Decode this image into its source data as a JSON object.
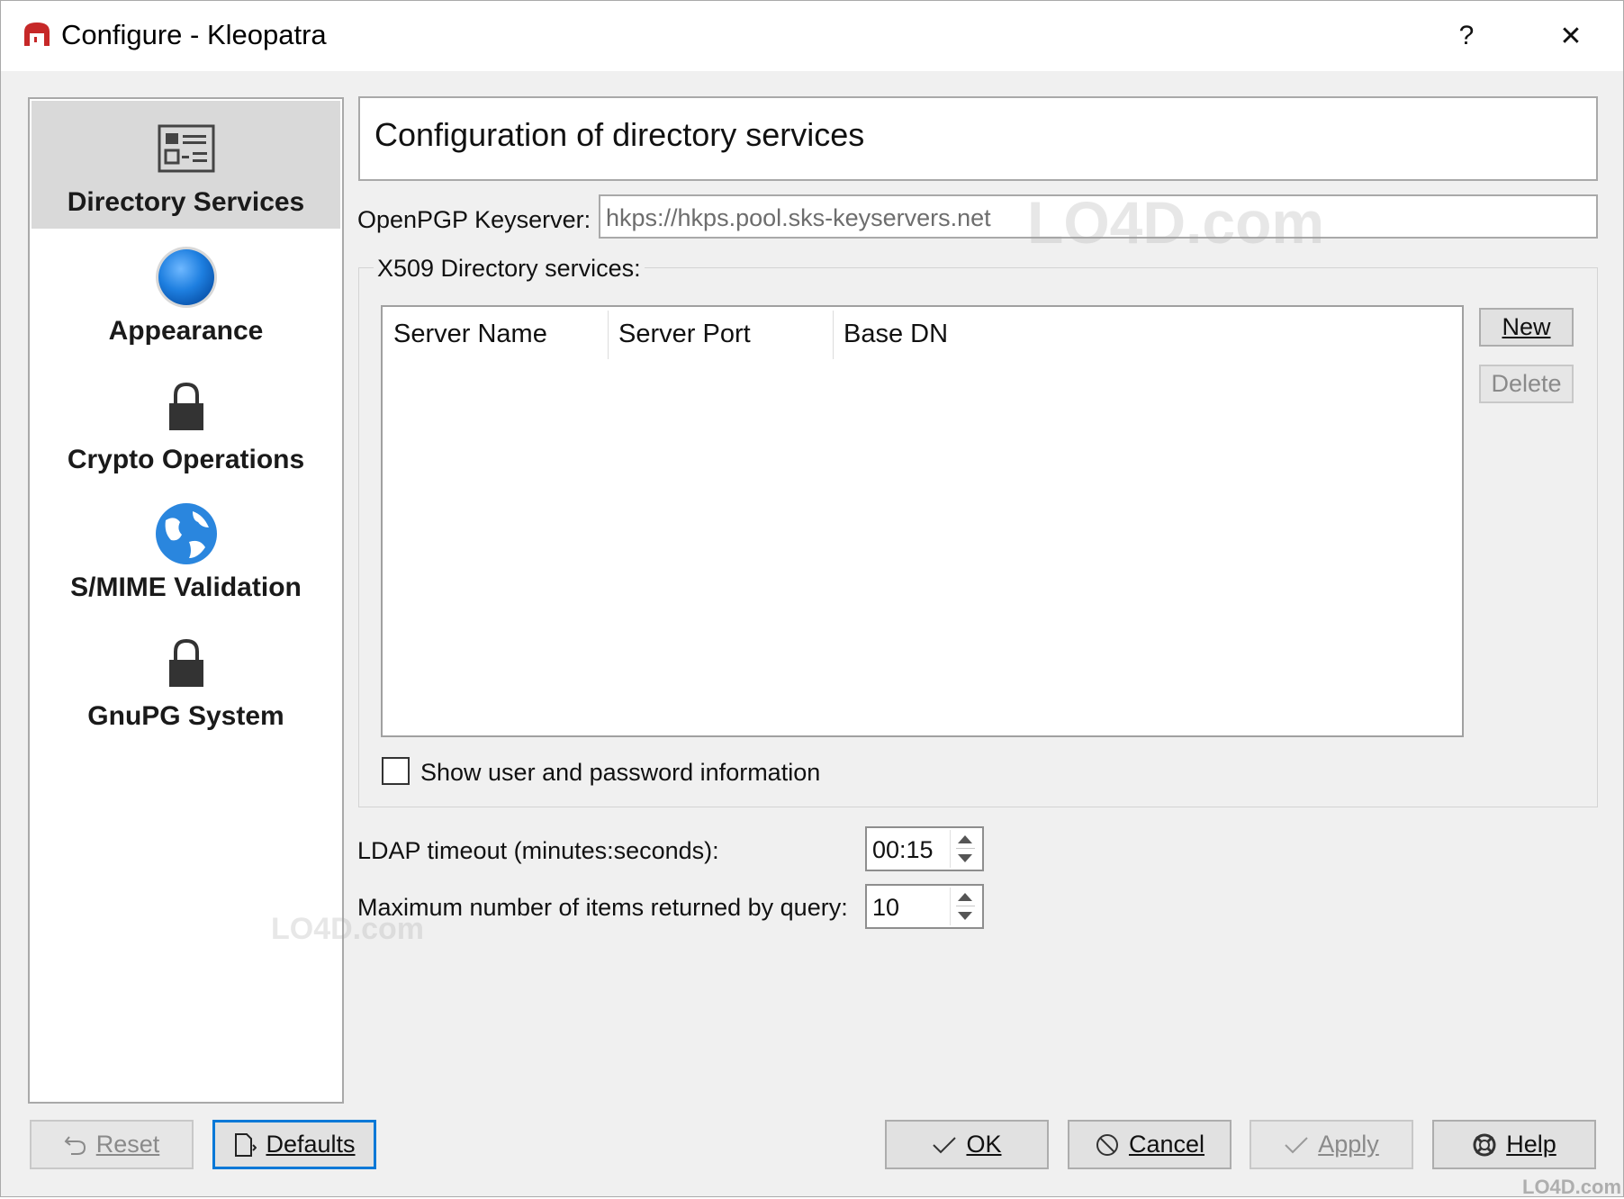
{
  "window": {
    "title": "Configure - Kleopatra",
    "help_glyph": "?",
    "close_glyph": "✕"
  },
  "sidebar": {
    "items": [
      {
        "label": "Directory Services",
        "icon": "address-card-icon",
        "selected": true
      },
      {
        "label": "Appearance",
        "icon": "blue-sphere-icon",
        "selected": false
      },
      {
        "label": "Crypto Operations",
        "icon": "padlock-icon",
        "selected": false
      },
      {
        "label": "S/MIME Validation",
        "icon": "globe-icon",
        "selected": false
      },
      {
        "label": "GnuPG System",
        "icon": "padlock-icon",
        "selected": false
      }
    ]
  },
  "main": {
    "header_title": "Configuration of directory services",
    "keyserver_label": "OpenPGP Keyserver:",
    "keyserver_value": "hkps://hkps.pool.sks-keyservers.net",
    "x509_group_title": "X509 Directory services:",
    "table_columns": [
      "Server Name",
      "Server Port",
      "Base DN"
    ],
    "new_button": "New",
    "delete_button": "Delete",
    "show_user_checkbox_label": "Show user and password information",
    "show_user_checked": false,
    "ldap_timeout_label": "LDAP timeout (minutes:seconds):",
    "ldap_timeout_value": "00:15",
    "max_items_label": "Maximum number of items returned by query:",
    "max_items_value": "10"
  },
  "footer": {
    "reset_button": "Reset",
    "defaults_button": "Defaults",
    "ok_button": "OK",
    "cancel_button": "Cancel",
    "apply_button": "Apply",
    "help_button": "Help"
  },
  "watermark": "LO4D.com",
  "colors": {
    "focus_border": "#0078d7",
    "selected_bg": "#d9d9d9",
    "app_icon_red": "#c62828",
    "appearance_blue": "#1e7fe0"
  }
}
